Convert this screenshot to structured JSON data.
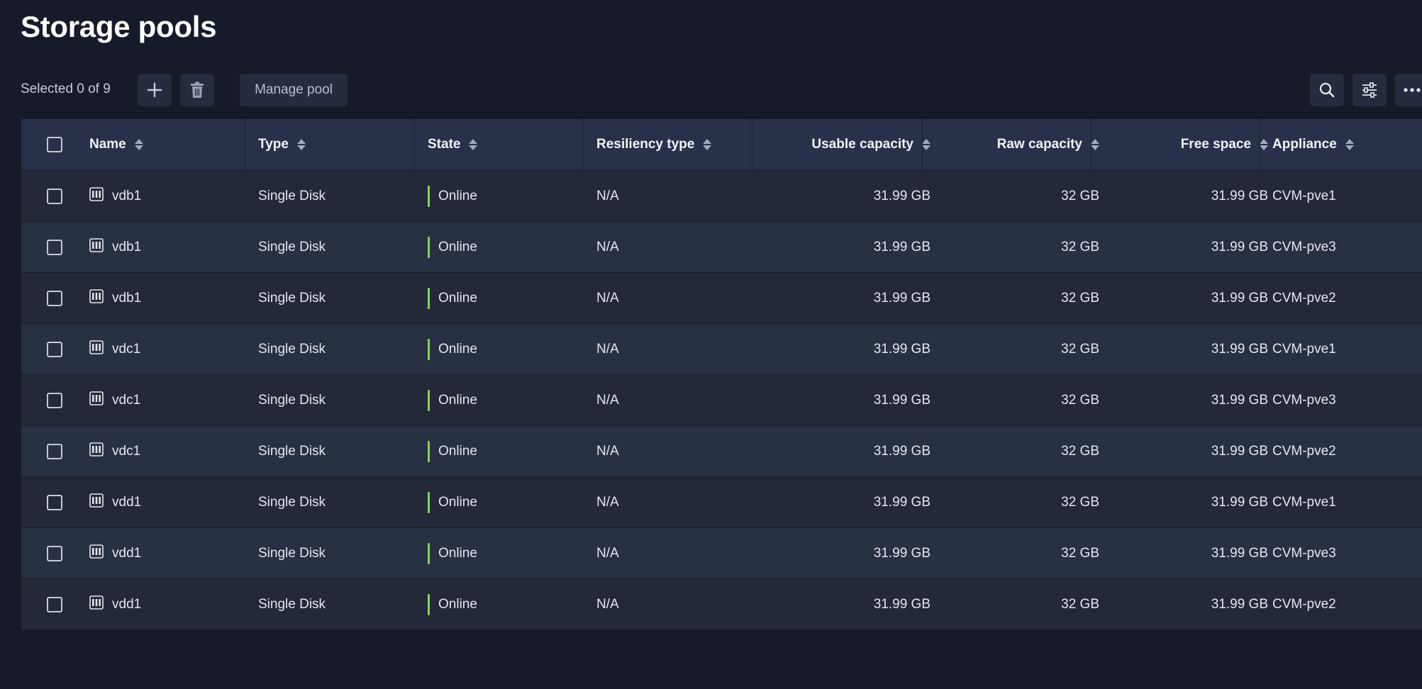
{
  "page": {
    "title": "Storage pools",
    "selection_text": "Selected 0 of 9"
  },
  "toolbar": {
    "add_icon": "plus-icon",
    "delete_icon": "trash-icon",
    "manage_label": "Manage pool",
    "search_icon": "search-icon",
    "filter_icon": "sliders-icon",
    "more_icon": "ellipsis-icon"
  },
  "table": {
    "columns": [
      {
        "label": "Name"
      },
      {
        "label": "Type"
      },
      {
        "label": "State"
      },
      {
        "label": "Resiliency type"
      },
      {
        "label": "Usable capacity"
      },
      {
        "label": "Raw capacity"
      },
      {
        "label": "Free space"
      },
      {
        "label": "Appliance"
      }
    ],
    "rows": [
      {
        "name": "vdb1",
        "type": "Single Disk",
        "state": "Online",
        "resiliency": "N/A",
        "usable": "31.99 GB",
        "raw": "32 GB",
        "free": "31.99 GB",
        "appliance": "CVM-pve1"
      },
      {
        "name": "vdb1",
        "type": "Single Disk",
        "state": "Online",
        "resiliency": "N/A",
        "usable": "31.99 GB",
        "raw": "32 GB",
        "free": "31.99 GB",
        "appliance": "CVM-pve3"
      },
      {
        "name": "vdb1",
        "type": "Single Disk",
        "state": "Online",
        "resiliency": "N/A",
        "usable": "31.99 GB",
        "raw": "32 GB",
        "free": "31.99 GB",
        "appliance": "CVM-pve2"
      },
      {
        "name": "vdc1",
        "type": "Single Disk",
        "state": "Online",
        "resiliency": "N/A",
        "usable": "31.99 GB",
        "raw": "32 GB",
        "free": "31.99 GB",
        "appliance": "CVM-pve1"
      },
      {
        "name": "vdc1",
        "type": "Single Disk",
        "state": "Online",
        "resiliency": "N/A",
        "usable": "31.99 GB",
        "raw": "32 GB",
        "free": "31.99 GB",
        "appliance": "CVM-pve3"
      },
      {
        "name": "vdc1",
        "type": "Single Disk",
        "state": "Online",
        "resiliency": "N/A",
        "usable": "31.99 GB",
        "raw": "32 GB",
        "free": "31.99 GB",
        "appliance": "CVM-pve2"
      },
      {
        "name": "vdd1",
        "type": "Single Disk",
        "state": "Online",
        "resiliency": "N/A",
        "usable": "31.99 GB",
        "raw": "32 GB",
        "free": "31.99 GB",
        "appliance": "CVM-pve1"
      },
      {
        "name": "vdd1",
        "type": "Single Disk",
        "state": "Online",
        "resiliency": "N/A",
        "usable": "31.99 GB",
        "raw": "32 GB",
        "free": "31.99 GB",
        "appliance": "CVM-pve3"
      },
      {
        "name": "vdd1",
        "type": "Single Disk",
        "state": "Online",
        "resiliency": "N/A",
        "usable": "31.99 GB",
        "raw": "32 GB",
        "free": "31.99 GB",
        "appliance": "CVM-pve2"
      }
    ]
  },
  "colors": {
    "background": "#161a29",
    "header_bg": "#293049",
    "row_odd": "#232939",
    "row_even": "#283044",
    "state_online": "#86d25c"
  }
}
